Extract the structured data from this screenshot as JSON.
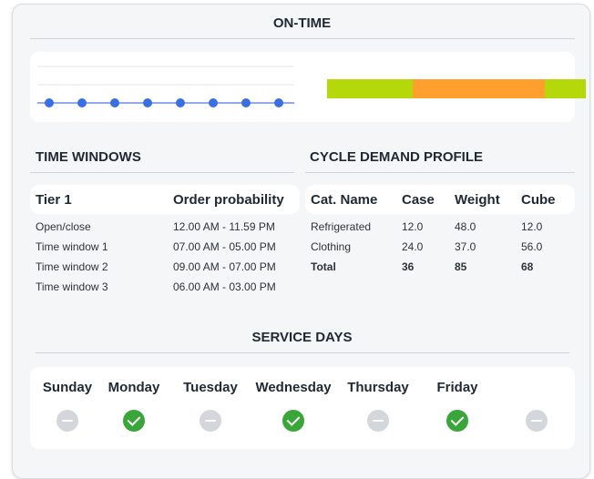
{
  "on_time": {
    "title": "ON-TIME",
    "dot_count": 8,
    "bar_segments": [
      {
        "color": "#b5d80b",
        "fraction": 0.33
      },
      {
        "color": "#ff9f2e",
        "fraction": 0.51
      },
      {
        "color": "#b5d80b",
        "fraction": 0.16
      }
    ]
  },
  "time_windows": {
    "title": "TIME WINDOWS",
    "col1": "Tier 1",
    "col2": "Order probability",
    "rows": [
      {
        "name": "Open/close",
        "value": "12.00 AM - 11.59 PM"
      },
      {
        "name": "Time window 1",
        "value": "07.00 AM - 05.00 PM"
      },
      {
        "name": "Time window 2",
        "value": "09.00 AM - 07.00 PM"
      },
      {
        "name": "Time window 3",
        "value": "06.00 AM - 03.00 PM"
      }
    ]
  },
  "cycle_demand": {
    "title": "CYCLE DEMAND PROFILE",
    "columns": [
      "Cat. Name",
      "Case",
      "Weight",
      "Cube"
    ],
    "rows": [
      [
        "Refrigerated",
        "12.0",
        "48.0",
        "12.0"
      ],
      [
        "Clothing",
        "24.0",
        "37.0",
        "56.0"
      ]
    ],
    "total": [
      "Total",
      "36",
      "85",
      "68"
    ]
  },
  "service_days": {
    "title": "SERVICE DAYS",
    "days": [
      {
        "label": "Sunday",
        "active": false
      },
      {
        "label": "Monday",
        "active": true
      },
      {
        "label": "Tuesday",
        "active": false
      },
      {
        "label": "Wednesday",
        "active": true
      },
      {
        "label": "Thursday",
        "active": false
      },
      {
        "label": "Friday",
        "active": true
      },
      {
        "label": "",
        "active": false
      }
    ],
    "colors": {
      "active": "#3aa63a",
      "inactive": "#d3d6da"
    }
  },
  "colors": {
    "dot": "#3b6fe0",
    "line": "#6d8fe8"
  }
}
